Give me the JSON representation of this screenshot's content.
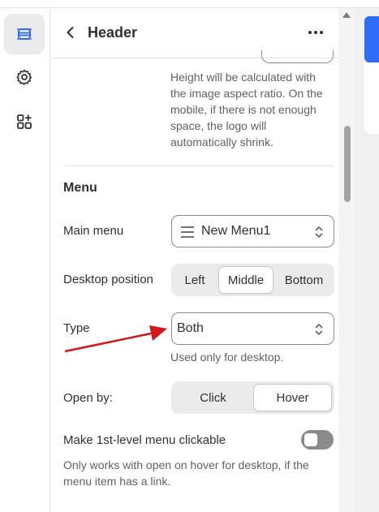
{
  "panel": {
    "title": "Header",
    "logo_help": [
      "Height will be calculated with",
      "the image aspect ratio. On the",
      "mobile, if there is not enough",
      "space, the logo will",
      "automatically shrink."
    ]
  },
  "menu_section": {
    "title": "Menu",
    "main_menu": {
      "label": "Main menu",
      "value": "New Menu1"
    },
    "desktop_position": {
      "label": "Desktop position",
      "options": [
        "Left",
        "Middle",
        "Bottom"
      ],
      "selected": "Middle"
    },
    "type": {
      "label": "Type",
      "value": "Both",
      "help": "Used only for desktop."
    },
    "open_by": {
      "label": "Open by:",
      "options": [
        "Click",
        "Hover"
      ],
      "selected": "Hover"
    },
    "clickable": {
      "label": "Make 1st-level menu clickable",
      "enabled": false,
      "help": [
        "Only works with open on hover for desktop, if the",
        "menu item has a link."
      ]
    }
  },
  "icons": {
    "rail": [
      "sections-icon",
      "gear-icon",
      "add-apps-icon"
    ],
    "header": [
      "back-chevron-icon",
      "more-icon"
    ]
  },
  "colors": {
    "accent": "#2f6bff",
    "annotation_arrow": "#d0181b",
    "toggle_off": "#8a8a8a"
  }
}
